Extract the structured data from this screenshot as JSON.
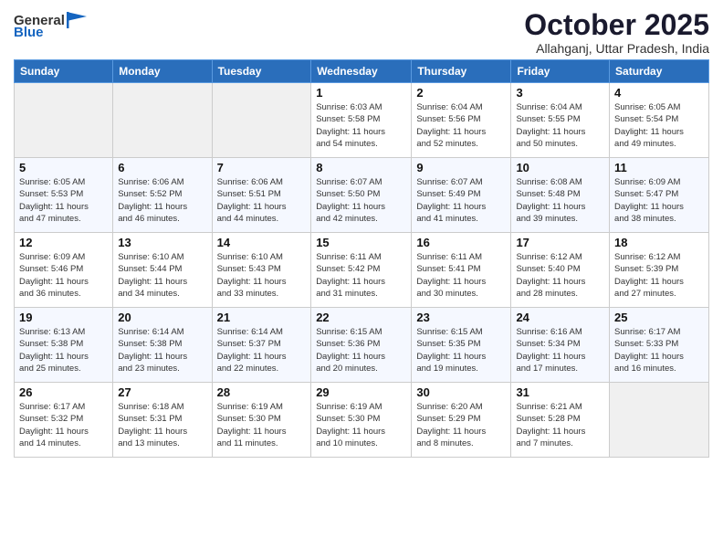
{
  "header": {
    "logo_general": "General",
    "logo_blue": "Blue",
    "month_title": "October 2025",
    "location": "Allahganj, Uttar Pradesh, India"
  },
  "weekdays": [
    "Sunday",
    "Monday",
    "Tuesday",
    "Wednesday",
    "Thursday",
    "Friday",
    "Saturday"
  ],
  "weeks": [
    [
      {
        "day": "",
        "info": ""
      },
      {
        "day": "",
        "info": ""
      },
      {
        "day": "",
        "info": ""
      },
      {
        "day": "1",
        "info": "Sunrise: 6:03 AM\nSunset: 5:58 PM\nDaylight: 11 hours\nand 54 minutes."
      },
      {
        "day": "2",
        "info": "Sunrise: 6:04 AM\nSunset: 5:56 PM\nDaylight: 11 hours\nand 52 minutes."
      },
      {
        "day": "3",
        "info": "Sunrise: 6:04 AM\nSunset: 5:55 PM\nDaylight: 11 hours\nand 50 minutes."
      },
      {
        "day": "4",
        "info": "Sunrise: 6:05 AM\nSunset: 5:54 PM\nDaylight: 11 hours\nand 49 minutes."
      }
    ],
    [
      {
        "day": "5",
        "info": "Sunrise: 6:05 AM\nSunset: 5:53 PM\nDaylight: 11 hours\nand 47 minutes."
      },
      {
        "day": "6",
        "info": "Sunrise: 6:06 AM\nSunset: 5:52 PM\nDaylight: 11 hours\nand 46 minutes."
      },
      {
        "day": "7",
        "info": "Sunrise: 6:06 AM\nSunset: 5:51 PM\nDaylight: 11 hours\nand 44 minutes."
      },
      {
        "day": "8",
        "info": "Sunrise: 6:07 AM\nSunset: 5:50 PM\nDaylight: 11 hours\nand 42 minutes."
      },
      {
        "day": "9",
        "info": "Sunrise: 6:07 AM\nSunset: 5:49 PM\nDaylight: 11 hours\nand 41 minutes."
      },
      {
        "day": "10",
        "info": "Sunrise: 6:08 AM\nSunset: 5:48 PM\nDaylight: 11 hours\nand 39 minutes."
      },
      {
        "day": "11",
        "info": "Sunrise: 6:09 AM\nSunset: 5:47 PM\nDaylight: 11 hours\nand 38 minutes."
      }
    ],
    [
      {
        "day": "12",
        "info": "Sunrise: 6:09 AM\nSunset: 5:46 PM\nDaylight: 11 hours\nand 36 minutes."
      },
      {
        "day": "13",
        "info": "Sunrise: 6:10 AM\nSunset: 5:44 PM\nDaylight: 11 hours\nand 34 minutes."
      },
      {
        "day": "14",
        "info": "Sunrise: 6:10 AM\nSunset: 5:43 PM\nDaylight: 11 hours\nand 33 minutes."
      },
      {
        "day": "15",
        "info": "Sunrise: 6:11 AM\nSunset: 5:42 PM\nDaylight: 11 hours\nand 31 minutes."
      },
      {
        "day": "16",
        "info": "Sunrise: 6:11 AM\nSunset: 5:41 PM\nDaylight: 11 hours\nand 30 minutes."
      },
      {
        "day": "17",
        "info": "Sunrise: 6:12 AM\nSunset: 5:40 PM\nDaylight: 11 hours\nand 28 minutes."
      },
      {
        "day": "18",
        "info": "Sunrise: 6:12 AM\nSunset: 5:39 PM\nDaylight: 11 hours\nand 27 minutes."
      }
    ],
    [
      {
        "day": "19",
        "info": "Sunrise: 6:13 AM\nSunset: 5:38 PM\nDaylight: 11 hours\nand 25 minutes."
      },
      {
        "day": "20",
        "info": "Sunrise: 6:14 AM\nSunset: 5:38 PM\nDaylight: 11 hours\nand 23 minutes."
      },
      {
        "day": "21",
        "info": "Sunrise: 6:14 AM\nSunset: 5:37 PM\nDaylight: 11 hours\nand 22 minutes."
      },
      {
        "day": "22",
        "info": "Sunrise: 6:15 AM\nSunset: 5:36 PM\nDaylight: 11 hours\nand 20 minutes."
      },
      {
        "day": "23",
        "info": "Sunrise: 6:15 AM\nSunset: 5:35 PM\nDaylight: 11 hours\nand 19 minutes."
      },
      {
        "day": "24",
        "info": "Sunrise: 6:16 AM\nSunset: 5:34 PM\nDaylight: 11 hours\nand 17 minutes."
      },
      {
        "day": "25",
        "info": "Sunrise: 6:17 AM\nSunset: 5:33 PM\nDaylight: 11 hours\nand 16 minutes."
      }
    ],
    [
      {
        "day": "26",
        "info": "Sunrise: 6:17 AM\nSunset: 5:32 PM\nDaylight: 11 hours\nand 14 minutes."
      },
      {
        "day": "27",
        "info": "Sunrise: 6:18 AM\nSunset: 5:31 PM\nDaylight: 11 hours\nand 13 minutes."
      },
      {
        "day": "28",
        "info": "Sunrise: 6:19 AM\nSunset: 5:30 PM\nDaylight: 11 hours\nand 11 minutes."
      },
      {
        "day": "29",
        "info": "Sunrise: 6:19 AM\nSunset: 5:30 PM\nDaylight: 11 hours\nand 10 minutes."
      },
      {
        "day": "30",
        "info": "Sunrise: 6:20 AM\nSunset: 5:29 PM\nDaylight: 11 hours\nand 8 minutes."
      },
      {
        "day": "31",
        "info": "Sunrise: 6:21 AM\nSunset: 5:28 PM\nDaylight: 11 hours\nand 7 minutes."
      },
      {
        "day": "",
        "info": ""
      }
    ]
  ]
}
